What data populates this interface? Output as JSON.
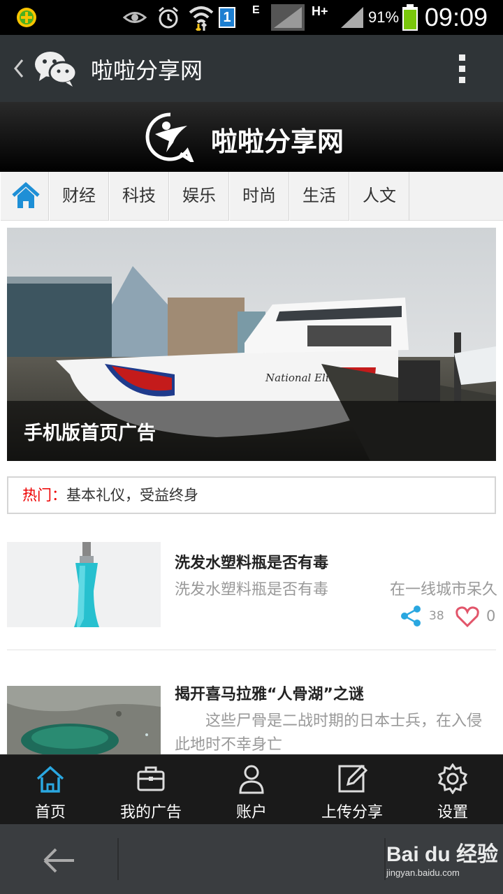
{
  "status_bar": {
    "battery_pct": "91%",
    "time": "09:09",
    "network_type": "H+",
    "network_type2": "E",
    "sim_badge": "1"
  },
  "wechat_bar": {
    "title": "啦啦分享网"
  },
  "site_header": {
    "name": "啦啦分享网"
  },
  "nav": {
    "tabs": [
      "财经",
      "科技",
      "娱乐",
      "时尚",
      "生活",
      "人文"
    ]
  },
  "banner": {
    "caption": "手机版首页广告",
    "boat_name": "National Elite"
  },
  "hot": {
    "label": "热门：",
    "text": "基本礼仪，受益终身"
  },
  "articles": [
    {
      "title": "洗发水塑料瓶是否有毒",
      "summary": "洗发水塑料瓶是否有毒　　　　在一线城市呆久",
      "shares": "38",
      "likes": "0"
    },
    {
      "title": "揭开喜马拉雅“人骨湖”之谜",
      "summary": "　　这些尸骨是二战时期的日本士兵，在入侵此地时不幸身亡"
    }
  ],
  "tabbar": {
    "items": [
      "首页",
      "我的广告",
      "账户",
      "上传分享",
      "设置"
    ]
  },
  "colors": {
    "accent": "#2aa7e0",
    "hot_red": "#ee0000"
  },
  "watermark": {
    "brand": "Bai du 经验",
    "url": "jingyan.baidu.com"
  }
}
